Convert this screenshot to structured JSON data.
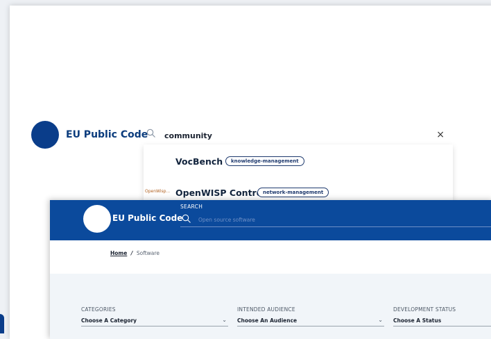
{
  "back": {
    "brand": "EU Public Code",
    "search_query": "community",
    "clear_symbol": "×",
    "results": [
      {
        "name": "VocBench 3",
        "tag": "knowledge-management",
        "thumb": ""
      },
      {
        "name": "OpenWISP Controller",
        "tag": "network-management",
        "thumb": "OpenWisp..."
      }
    ]
  },
  "front": {
    "brand": "EU Public Code",
    "search_label": "SEARCH",
    "search_placeholder": "Open source software",
    "breadcrumb": {
      "home": "Home",
      "separator": "/",
      "current": "Software"
    },
    "filters": [
      {
        "label": "CATEGORIES",
        "value": "Choose A Category"
      },
      {
        "label": "INTENDED AUDIENCE",
        "value": "Choose An Audience"
      },
      {
        "label": "DEVELOPMENT STATUS",
        "value": "Choose A Status"
      }
    ],
    "chevron": "⌄"
  },
  "colors": {
    "brand_blue": "#0b4a9c",
    "logo_dark": "#0a3d8a",
    "text_dark": "#12243d"
  },
  "icons": [
    "search-icon",
    "close-icon",
    "chevron-down-icon"
  ]
}
